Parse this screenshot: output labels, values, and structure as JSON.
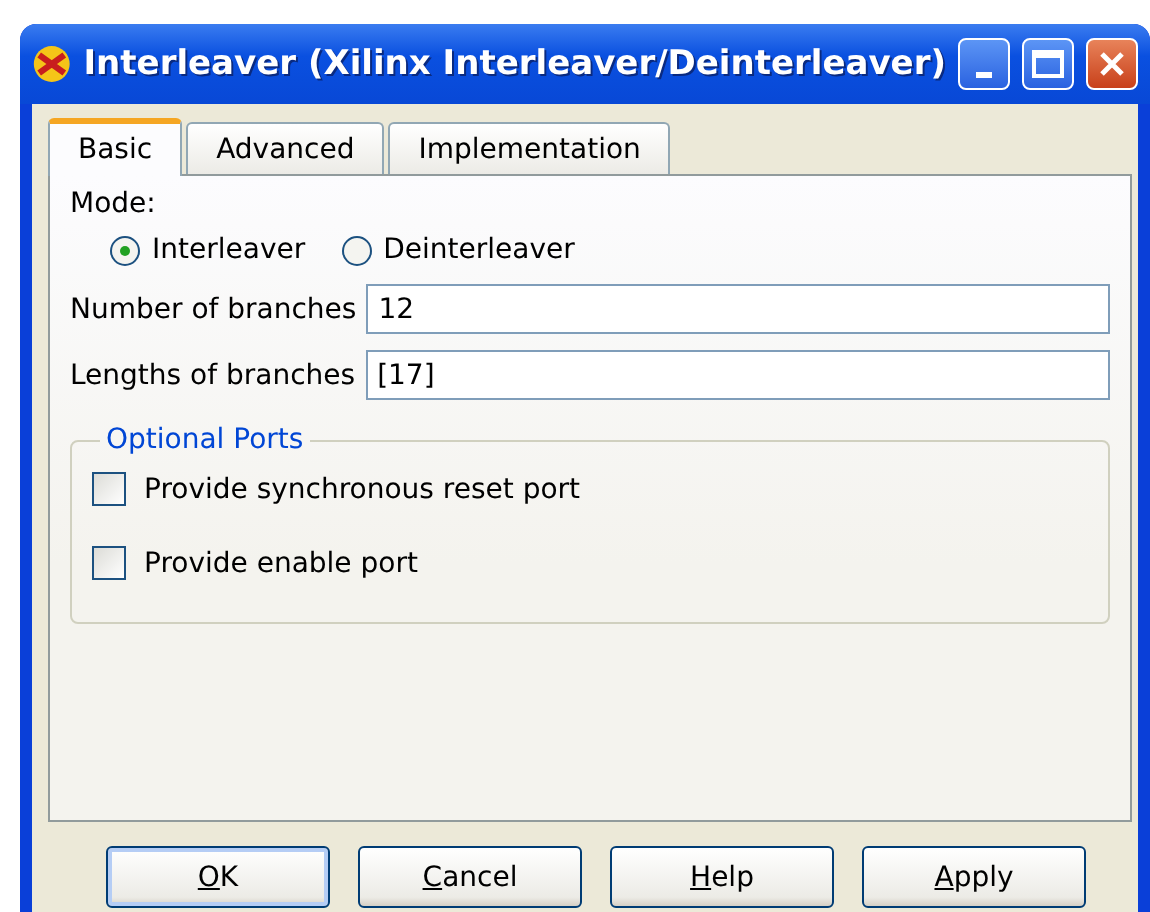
{
  "window": {
    "title": "Interleaver (Xilinx Interleaver/Deinterleaver)"
  },
  "tabs": [
    {
      "label": "Basic",
      "selected": true
    },
    {
      "label": "Advanced",
      "selected": false
    },
    {
      "label": "Implementation",
      "selected": false
    }
  ],
  "mode": {
    "label": "Mode:",
    "options": [
      {
        "label": "Interleaver",
        "selected": true
      },
      {
        "label": "Deinterleaver",
        "selected": false
      }
    ]
  },
  "fields": [
    {
      "label": "Number of branches",
      "value": "12"
    },
    {
      "label": "Lengths of branches",
      "value": "[17]"
    }
  ],
  "optional_ports": {
    "title": "Optional Ports",
    "items": [
      {
        "label": "Provide synchronous reset port",
        "checked": false
      },
      {
        "label": "Provide enable port",
        "checked": false
      }
    ]
  },
  "buttons": [
    {
      "label": "OK",
      "default": true
    },
    {
      "label": "Cancel",
      "default": false
    },
    {
      "label": "Help",
      "default": false
    },
    {
      "label": "Apply",
      "default": false
    }
  ]
}
